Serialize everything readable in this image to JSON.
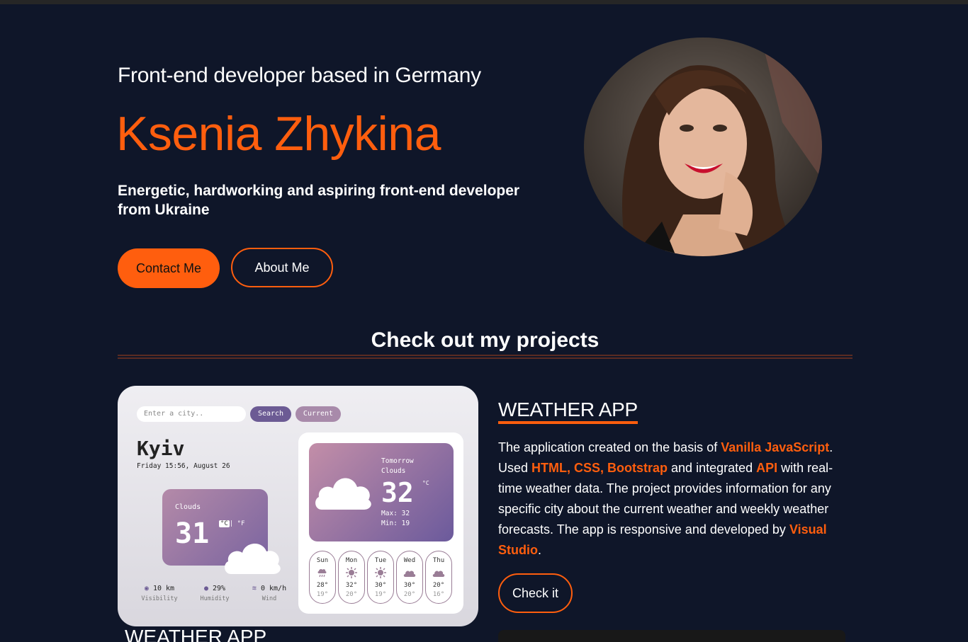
{
  "hero": {
    "subtitle": "Front-end developer based in Germany",
    "name": "Ksenia Zhykina",
    "description": "Energetic, hardworking and aspiring front-end developer from Ukraine",
    "contact_label": "Contact Me",
    "about_label": "About Me"
  },
  "colors": {
    "accent": "#ff5e0e",
    "background": "#0f1629"
  },
  "projects": {
    "section_title": "Check out my projects",
    "project_title": "WEATHER APP",
    "desc_1": "The application created on the basis of ",
    "hl_1": "Vanilla JavaScript",
    "desc_2": ". Used ",
    "hl_2": "HTML, CSS, Bootstrap",
    "desc_3": " and integrated ",
    "hl_3": "API",
    "desc_4": " with real-time weather data. The project provides information for any specific city about the current weather and weekly weather forecasts. The app is responsive and developed by ",
    "hl_4": "Visual Studio",
    "desc_5": ".",
    "check_label": "Check it",
    "next_title": "WEATHER APP"
  },
  "weather_preview": {
    "search_placeholder": "Enter a city..",
    "search_label": "Search",
    "current_label": "Current",
    "city": "Kyiv",
    "date": "Friday 15:56, August 26",
    "condition": "Clouds",
    "temp": "31",
    "unit_c": "°C",
    "unit_f": "| °F",
    "metrics": [
      {
        "value": "10 km",
        "label": "Visibility",
        "icon": "eye-icon"
      },
      {
        "value": "29%",
        "label": "Humidity",
        "icon": "drop-icon"
      },
      {
        "value": "0 km/h",
        "label": "Wind",
        "icon": "wind-icon"
      }
    ],
    "tomorrow": {
      "label": "Tomorrow",
      "condition": "Clouds",
      "temp": "32",
      "unit": "°C",
      "max": "Max: 32",
      "min": "Min: 19"
    },
    "forecast": [
      {
        "day": "Sun",
        "high": "28°",
        "low": "19°",
        "icon": "rain-cloud-icon"
      },
      {
        "day": "Mon",
        "high": "32°",
        "low": "20°",
        "icon": "sun-icon"
      },
      {
        "day": "Tue",
        "high": "30°",
        "low": "19°",
        "icon": "sun-icon"
      },
      {
        "day": "Wed",
        "high": "30°",
        "low": "20°",
        "icon": "cloud-icon"
      },
      {
        "day": "Thu",
        "high": "20°",
        "low": "16°",
        "icon": "cloud-icon"
      }
    ]
  }
}
